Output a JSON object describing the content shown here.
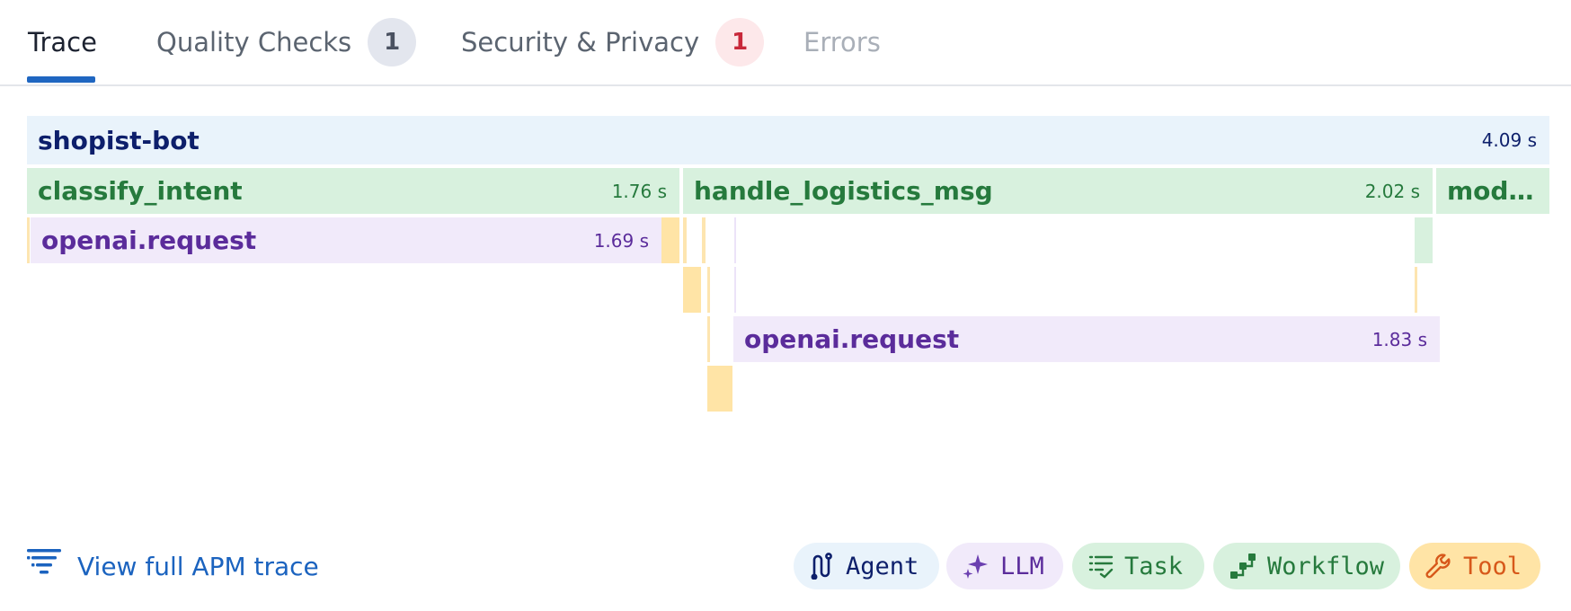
{
  "tabs": [
    {
      "label": "Trace",
      "active": true
    },
    {
      "label": "Quality Checks",
      "count": "1"
    },
    {
      "label": "Security & Privacy",
      "count": "1"
    },
    {
      "label": "Errors",
      "disabled": true
    }
  ],
  "spans": {
    "root": {
      "name": "shopist-bot",
      "duration": "4.09 s"
    },
    "classify_intent": {
      "name": "classify_intent",
      "duration": "1.76 s"
    },
    "handle_logistics_msg": {
      "name": "handle_logistics_msg",
      "duration": "2.02 s"
    },
    "truncated": {
      "name": "mod…"
    },
    "openai_request_1": {
      "name": "openai.request",
      "duration": "1.69 s"
    },
    "openai_request_2": {
      "name": "openai.request",
      "duration": "1.83 s"
    }
  },
  "footer": {
    "apm_link": "View full APM trace",
    "legend": [
      {
        "label": "Agent",
        "icon": "agent-icon"
      },
      {
        "label": "LLM",
        "icon": "sparkle-icon"
      },
      {
        "label": "Task",
        "icon": "checklist-icon"
      },
      {
        "label": "Workflow",
        "icon": "workflow-icon"
      },
      {
        "label": "Tool",
        "icon": "wrench-icon"
      }
    ]
  },
  "colors": {
    "agent": "#e9f3fb",
    "workflow": "#d8f1de",
    "llm": "#f1eafa",
    "tool": "#ffe4a6",
    "accent": "#1f66c1",
    "danger": "#c8283a"
  }
}
